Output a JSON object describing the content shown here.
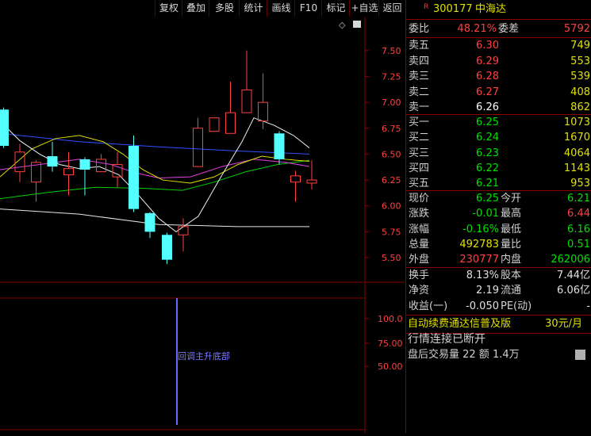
{
  "toolbar": [
    "复权",
    "叠加",
    "多股",
    "统计",
    "画线",
    "F10",
    "标记",
    "+自选",
    "返回"
  ],
  "stock": {
    "r_mark": "R",
    "code": "300177",
    "name": "中海达"
  },
  "weibi": {
    "label": "委比",
    "value": "48.21%",
    "diff_label": "委差",
    "diff": "5792"
  },
  "sell": [
    {
      "label": "卖五",
      "price": "6.30",
      "vol": "749"
    },
    {
      "label": "卖四",
      "price": "6.29",
      "vol": "553"
    },
    {
      "label": "卖三",
      "price": "6.28",
      "vol": "539"
    },
    {
      "label": "卖二",
      "price": "6.27",
      "vol": "408"
    },
    {
      "label": "卖一",
      "price": "6.26",
      "vol": "862"
    }
  ],
  "buy": [
    {
      "label": "买一",
      "price": "6.25",
      "vol": "1073"
    },
    {
      "label": "买二",
      "price": "6.24",
      "vol": "1670"
    },
    {
      "label": "买三",
      "price": "6.23",
      "vol": "4064"
    },
    {
      "label": "买四",
      "price": "6.22",
      "vol": "1143"
    },
    {
      "label": "买五",
      "price": "6.21",
      "vol": "953"
    }
  ],
  "stats": [
    {
      "l1": "现价",
      "v1": "6.25",
      "l2": "今开",
      "v2": "6.21",
      "c1": "#00e000",
      "c2": "#00e000"
    },
    {
      "l1": "涨跌",
      "v1": "-0.01",
      "l2": "最高",
      "v2": "6.44",
      "c1": "#00e000",
      "c2": "#ff4040"
    },
    {
      "l1": "涨幅",
      "v1": "-0.16%",
      "l2": "最低",
      "v2": "6.16",
      "c1": "#00e000",
      "c2": "#00e000"
    },
    {
      "l1": "总量",
      "v1": "492783",
      "l2": "量比",
      "v2": "0.51",
      "c1": "#e0e000",
      "c2": "#00e000"
    },
    {
      "l1": "外盘",
      "v1": "230777",
      "l2": "内盘",
      "v2": "262006",
      "c1": "#ff4040",
      "c2": "#00e000"
    }
  ],
  "fin": [
    {
      "l1": "换手",
      "v1": "8.13%",
      "l2": "股本",
      "v2": "7.44亿"
    },
    {
      "l1": "净资",
      "v1": "2.19",
      "l2": "流通",
      "v2": "6.06亿"
    },
    {
      "l1": "收益(一)",
      "v1": "-0.050",
      "l2": "PE(动)",
      "v2": "-"
    }
  ],
  "promo": {
    "text": "自动续费通达信普及版",
    "price": "30元/月"
  },
  "status": "行情连接已断开",
  "after_hours": "盘后交易量 22 额 1.4万",
  "chart_data": {
    "type": "candlestick",
    "y_ticks": [
      "7.50",
      "7.25",
      "7.00",
      "6.75",
      "6.50",
      "6.25",
      "6.00",
      "5.75",
      "5.50"
    ],
    "y_range": [
      5.37,
      7.82
    ],
    "candles": [
      {
        "o": 6.93,
        "c": 6.58,
        "h": 6.95,
        "l": 6.56,
        "dir": "down"
      },
      {
        "o": 6.33,
        "c": 6.52,
        "h": 6.6,
        "l": 6.23,
        "dir": "up"
      },
      {
        "o": 6.23,
        "c": 6.42,
        "h": 6.44,
        "l": 6.04,
        "dir": "up"
      },
      {
        "o": 6.48,
        "c": 6.38,
        "h": 6.62,
        "l": 6.33,
        "dir": "down"
      },
      {
        "o": 6.3,
        "c": 6.36,
        "h": 6.52,
        "l": 6.1,
        "dir": "up"
      },
      {
        "o": 6.45,
        "c": 6.35,
        "h": 6.47,
        "l": 6.1,
        "dir": "down"
      },
      {
        "o": 6.33,
        "c": 6.45,
        "h": 6.5,
        "l": 6.33,
        "dir": "up"
      },
      {
        "o": 6.28,
        "c": 6.4,
        "h": 6.52,
        "l": 6.18,
        "dir": "up"
      },
      {
        "o": 6.58,
        "c": 5.97,
        "h": 6.68,
        "l": 5.94,
        "dir": "down"
      },
      {
        "o": 5.93,
        "c": 5.75,
        "h": 5.94,
        "l": 5.69,
        "dir": "down"
      },
      {
        "o": 5.72,
        "c": 5.48,
        "h": 5.74,
        "l": 5.44,
        "dir": "down"
      },
      {
        "o": 5.72,
        "c": 5.8,
        "h": 5.88,
        "l": 5.56,
        "dir": "up"
      },
      {
        "o": 6.38,
        "c": 6.75,
        "h": 6.85,
        "l": 6.38,
        "dir": "up"
      },
      {
        "o": 6.72,
        "c": 6.85,
        "h": 6.85,
        "l": 6.72,
        "dir": "up"
      },
      {
        "o": 6.7,
        "c": 6.9,
        "h": 7.2,
        "l": 6.7,
        "dir": "up"
      },
      {
        "o": 6.9,
        "c": 7.12,
        "h": 7.5,
        "l": 6.9,
        "dir": "up"
      },
      {
        "o": 7.0,
        "c": 6.82,
        "h": 7.28,
        "l": 6.74,
        "dir": "up"
      },
      {
        "o": 6.7,
        "c": 6.45,
        "h": 6.72,
        "l": 6.4,
        "dir": "down"
      },
      {
        "o": 6.29,
        "c": 6.23,
        "h": 6.34,
        "l": 6.04,
        "dir": "up"
      },
      {
        "o": 6.25,
        "c": 6.22,
        "h": 6.44,
        "l": 6.16,
        "dir": "up"
      }
    ],
    "ma_white": [
      [
        0,
        6.82
      ],
      [
        25,
        6.63
      ],
      [
        50,
        6.5
      ],
      [
        75,
        6.4
      ],
      [
        100,
        6.36
      ],
      [
        125,
        6.38
      ],
      [
        150,
        6.3
      ],
      [
        175,
        6.1
      ],
      [
        200,
        5.88
      ],
      [
        222,
        5.75
      ],
      [
        250,
        5.9
      ],
      [
        280,
        6.3
      ],
      [
        305,
        6.62
      ],
      [
        320,
        6.85
      ],
      [
        345,
        6.78
      ],
      [
        370,
        6.68
      ],
      [
        390,
        6.56
      ]
    ],
    "ma_yellow": [
      [
        0,
        6.28
      ],
      [
        40,
        6.55
      ],
      [
        70,
        6.65
      ],
      [
        100,
        6.68
      ],
      [
        130,
        6.62
      ],
      [
        155,
        6.5
      ],
      [
        180,
        6.35
      ],
      [
        205,
        6.25
      ],
      [
        240,
        6.22
      ],
      [
        270,
        6.28
      ],
      [
        300,
        6.4
      ],
      [
        330,
        6.48
      ],
      [
        360,
        6.45
      ],
      [
        390,
        6.43
      ]
    ],
    "ma_magenta": [
      [
        0,
        6.35
      ],
      [
        50,
        6.4
      ],
      [
        100,
        6.45
      ],
      [
        140,
        6.4
      ],
      [
        170,
        6.32
      ],
      [
        200,
        6.27
      ],
      [
        240,
        6.28
      ],
      [
        280,
        6.38
      ],
      [
        320,
        6.45
      ],
      [
        360,
        6.42
      ],
      [
        390,
        6.38
      ]
    ],
    "ma_green": [
      [
        0,
        6.07
      ],
      [
        60,
        6.13
      ],
      [
        120,
        6.18
      ],
      [
        180,
        6.17
      ],
      [
        230,
        6.15
      ],
      [
        270,
        6.23
      ],
      [
        310,
        6.33
      ],
      [
        350,
        6.4
      ],
      [
        390,
        6.44
      ]
    ],
    "ma_blue": [
      [
        0,
        6.7
      ],
      [
        100,
        6.62
      ],
      [
        200,
        6.57
      ],
      [
        300,
        6.53
      ],
      [
        390,
        6.5
      ]
    ],
    "ma_gray": [
      [
        0,
        5.97
      ],
      [
        100,
        5.92
      ],
      [
        200,
        5.82
      ],
      [
        300,
        5.8
      ],
      [
        390,
        5.8
      ]
    ],
    "indicator": {
      "ticks": [
        "100.0",
        "75.00",
        "50.00"
      ],
      "signal_label": "回调主升底部"
    }
  }
}
